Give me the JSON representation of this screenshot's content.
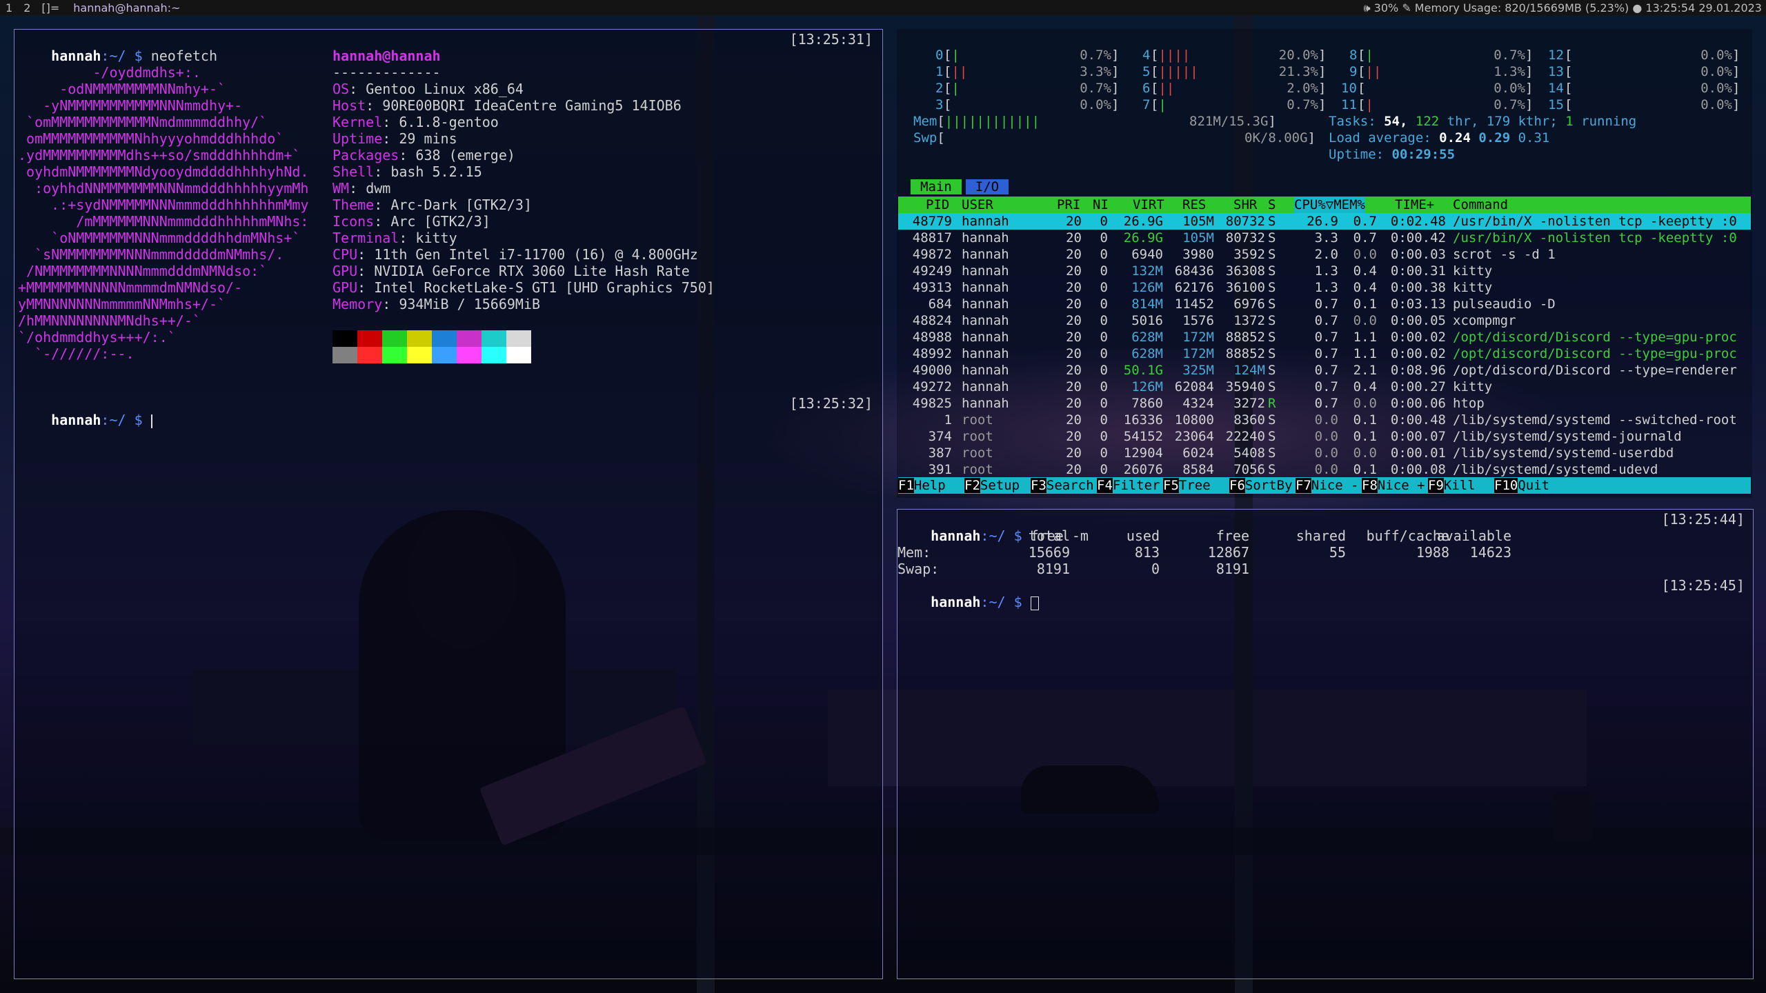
{
  "topbar": {
    "tags": [
      "1",
      "2"
    ],
    "layout": "[]=",
    "window_title": "hannah@hannah:~",
    "status": "🕪 30% ✎ Memory Usage: 820/15669MB (5.23%) ● 13:25:54 29.01.2023"
  },
  "left_terminal": {
    "cmd1": "neofetch",
    "ts1": "[13:25:31]",
    "ts2": "[13:25:32]",
    "prompt_user": "hannah",
    "prompt_path": ":~/ $",
    "ascii": [
      "         -/oyddmdhs+:.",
      "     -odNMMMMMMMMNNmhy+-`",
      "   -yNMMMMMMMMMMMNNNmmdhy+-",
      " `omMMMMMMMMMMMMNmdmmmmddhhy/`",
      " omMMMMMMMMMMMNhhyyyohmdddhhhdo`",
      ".ydMMMMMMMMMMdhs++so/smdddhhhhdm+`",
      " oyhdmNMMMMMMMNdyooydmddddhhhhyhNd.",
      "  :oyhhdNNMMMMMMMNNNmmdddhhhhhyymMh",
      "    .:+sydNMMMMMNNNmmmdddhhhhhhmMmy",
      "       /mMMMMMMNNNmmmdddhhhhhmMNhs:",
      "    `oNMMMMMMMNNNmmmddddhhdmMNhs+`",
      "  `sNMMMMMMMMNNNmmmdddddmNMmhs/.",
      " /NMMMMMMMMNNNNmmmdddmNMNdso:`",
      "+MMMMMMMNNNNNmmmmdmNMNdso/-",
      "yMMNNNNNNNmmmmmNNMmhs+/-`",
      "/hMMNNNNNNNNMNdhs++/-`",
      "`/ohdmmddhys+++/:.`",
      "  `-//////:--."
    ],
    "user_host": "hannah@hannah",
    "separator": "-------------",
    "info": [
      {
        "label": "OS",
        "value": "Gentoo Linux x86_64"
      },
      {
        "label": "Host",
        "value": "90RE00BQRI IdeaCentre Gaming5 14IOB6"
      },
      {
        "label": "Kernel",
        "value": "6.1.8-gentoo"
      },
      {
        "label": "Uptime",
        "value": "29 mins"
      },
      {
        "label": "Packages",
        "value": "638 (emerge)"
      },
      {
        "label": "Shell",
        "value": "bash 5.2.15"
      },
      {
        "label": "WM",
        "value": "dwm"
      },
      {
        "label": "Theme",
        "value": "Arc-Dark [GTK2/3]"
      },
      {
        "label": "Icons",
        "value": "Arc [GTK2/3]"
      },
      {
        "label": "Terminal",
        "value": "kitty"
      },
      {
        "label": "CPU",
        "value": "11th Gen Intel i7-11700 (16) @ 4.800GHz"
      },
      {
        "label": "GPU",
        "value": "NVIDIA GeForce RTX 3060 Lite Hash Rate"
      },
      {
        "label": "GPU",
        "value": "Intel RocketLake-S GT1 [UHD Graphics 750]"
      },
      {
        "label": "Memory",
        "value": "934MiB / 15669MiB"
      }
    ],
    "palette_top": [
      "#000000",
      "#cc0000",
      "#22cc22",
      "#cccc00",
      "#1e7fd6",
      "#c832c8",
      "#1ecbcb",
      "#d8d8d8"
    ],
    "palette_bottom": [
      "#808080",
      "#ff2a2a",
      "#33ff33",
      "#ffff2a",
      "#3aa0ff",
      "#ff44ff",
      "#2affff",
      "#ffffff"
    ]
  },
  "htop": {
    "cpus": [
      {
        "id": "0",
        "pct": "0.7%",
        "bars": "|"
      },
      {
        "id": "1",
        "pct": "3.3%",
        "bars": "||"
      },
      {
        "id": "2",
        "pct": "0.7%",
        "bars": "|"
      },
      {
        "id": "3",
        "pct": "0.0%",
        "bars": ""
      },
      {
        "id": "4",
        "pct": "20.0%",
        "bars": "||||"
      },
      {
        "id": "5",
        "pct": "21.3%",
        "bars": "|||||"
      },
      {
        "id": "6",
        "pct": "2.0%",
        "bars": "||"
      },
      {
        "id": "7",
        "pct": "0.7%",
        "bars": "|"
      },
      {
        "id": "8",
        "pct": "0.7%",
        "bars": "|"
      },
      {
        "id": "9",
        "pct": "1.3%",
        "bars": "||"
      },
      {
        "id": "10",
        "pct": "0.0%",
        "bars": ""
      },
      {
        "id": "11",
        "pct": "0.7%",
        "bars": "|"
      },
      {
        "id": "12",
        "pct": "0.0%",
        "bars": ""
      },
      {
        "id": "13",
        "pct": "0.0%",
        "bars": ""
      },
      {
        "id": "14",
        "pct": "0.0%",
        "bars": ""
      },
      {
        "id": "15",
        "pct": "0.0%",
        "bars": ""
      }
    ],
    "mem_label": "Mem",
    "mem_bars": "||||||||||||",
    "mem_value": "821M/15.3G",
    "swp_label": "Swp",
    "swp_value": "0K/8.00G",
    "tasks_label": "Tasks:",
    "tasks_n": "54,",
    "thr_n": "122",
    "tasks_rest": "thr, 179 kthr;",
    "running_n": "1",
    "running_label": "running",
    "load_label": "Load average:",
    "load1": "0.24",
    "load5": "0.29",
    "load15": "0.31",
    "uptime_label": "Uptime:",
    "uptime": "00:29:55",
    "tab_main": "Main",
    "tab_io": "I/O",
    "columns": [
      "PID",
      "USER",
      "PRI",
      "NI",
      "VIRT",
      "RES",
      "SHR",
      "S",
      "CPU%▽MEM%",
      "TIME+",
      "Command"
    ],
    "processes": [
      {
        "pid": "48779",
        "user": "hannah",
        "pri": "20",
        "ni": "0",
        "virt": "26.9G",
        "res": "105M",
        "shr": "80732",
        "s": "S",
        "cpu": "26.9",
        "mem": "0.7",
        "time": "0:02.48",
        "cmd": "/usr/bin/X -nolisten tcp -keeptty :0"
      },
      {
        "pid": "48817",
        "user": "hannah",
        "pri": "20",
        "ni": "0",
        "virt": "26.9G",
        "res": "105M",
        "shr": "80732",
        "s": "S",
        "cpu": "3.3",
        "mem": "0.7",
        "time": "0:00.42",
        "cmd": "/usr/bin/X -nolisten tcp -keeptty :0"
      },
      {
        "pid": "49872",
        "user": "hannah",
        "pri": "20",
        "ni": "0",
        "virt": "6940",
        "res": "3980",
        "shr": "3592",
        "s": "S",
        "cpu": "2.0",
        "mem": "0.0",
        "time": "0:00.03",
        "cmd": "scrot -s -d 1"
      },
      {
        "pid": "49249",
        "user": "hannah",
        "pri": "20",
        "ni": "0",
        "virt": "132M",
        "res": "68436",
        "shr": "36308",
        "s": "S",
        "cpu": "1.3",
        "mem": "0.4",
        "time": "0:00.31",
        "cmd": "kitty"
      },
      {
        "pid": "49313",
        "user": "hannah",
        "pri": "20",
        "ni": "0",
        "virt": "126M",
        "res": "62176",
        "shr": "36100",
        "s": "S",
        "cpu": "1.3",
        "mem": "0.4",
        "time": "0:00.38",
        "cmd": "kitty"
      },
      {
        "pid": "684",
        "user": "hannah",
        "pri": "20",
        "ni": "0",
        "virt": "814M",
        "res": "11452",
        "shr": "6976",
        "s": "S",
        "cpu": "0.7",
        "mem": "0.1",
        "time": "0:03.13",
        "cmd": "pulseaudio -D"
      },
      {
        "pid": "48824",
        "user": "hannah",
        "pri": "20",
        "ni": "0",
        "virt": "5016",
        "res": "1576",
        "shr": "1372",
        "s": "S",
        "cpu": "0.7",
        "mem": "0.0",
        "time": "0:00.05",
        "cmd": "xcompmgr"
      },
      {
        "pid": "48988",
        "user": "hannah",
        "pri": "20",
        "ni": "0",
        "virt": "628M",
        "res": "172M",
        "shr": "88852",
        "s": "S",
        "cpu": "0.7",
        "mem": "1.1",
        "time": "0:00.02",
        "cmd": "/opt/discord/Discord --type=gpu-proc"
      },
      {
        "pid": "48992",
        "user": "hannah",
        "pri": "20",
        "ni": "0",
        "virt": "628M",
        "res": "172M",
        "shr": "88852",
        "s": "S",
        "cpu": "0.7",
        "mem": "1.1",
        "time": "0:00.02",
        "cmd": "/opt/discord/Discord --type=gpu-proc"
      },
      {
        "pid": "49000",
        "user": "hannah",
        "pri": "20",
        "ni": "0",
        "virt": "50.1G",
        "res": "325M",
        "shr": "124M",
        "s": "S",
        "cpu": "0.7",
        "mem": "2.1",
        "time": "0:08.96",
        "cmd": "/opt/discord/Discord --type=renderer"
      },
      {
        "pid": "49272",
        "user": "hannah",
        "pri": "20",
        "ni": "0",
        "virt": "126M",
        "res": "62084",
        "shr": "35940",
        "s": "S",
        "cpu": "0.7",
        "mem": "0.4",
        "time": "0:00.27",
        "cmd": "kitty"
      },
      {
        "pid": "49825",
        "user": "hannah",
        "pri": "20",
        "ni": "0",
        "virt": "7860",
        "res": "4324",
        "shr": "3272",
        "s": "R",
        "cpu": "0.7",
        "mem": "0.0",
        "time": "0:00.06",
        "cmd": "htop"
      },
      {
        "pid": "1",
        "user": "root",
        "pri": "20",
        "ni": "0",
        "virt": "16336",
        "res": "10800",
        "shr": "8360",
        "s": "S",
        "cpu": "0.0",
        "mem": "0.1",
        "time": "0:00.48",
        "cmd": "/lib/systemd/systemd --switched-root"
      },
      {
        "pid": "374",
        "user": "root",
        "pri": "20",
        "ni": "0",
        "virt": "54152",
        "res": "23064",
        "shr": "22240",
        "s": "S",
        "cpu": "0.0",
        "mem": "0.1",
        "time": "0:00.07",
        "cmd": "/lib/systemd/systemd-journald"
      },
      {
        "pid": "387",
        "user": "root",
        "pri": "20",
        "ni": "0",
        "virt": "12904",
        "res": "6024",
        "shr": "5408",
        "s": "S",
        "cpu": "0.0",
        "mem": "0.0",
        "time": "0:00.01",
        "cmd": "/lib/systemd/systemd-userdbd"
      },
      {
        "pid": "391",
        "user": "root",
        "pri": "20",
        "ni": "0",
        "virt": "26076",
        "res": "8584",
        "shr": "7056",
        "s": "S",
        "cpu": "0.0",
        "mem": "0.1",
        "time": "0:00.08",
        "cmd": "/lib/systemd/systemd-udevd"
      }
    ],
    "fkeys": [
      {
        "key": "F1",
        "label": "Help"
      },
      {
        "key": "F2",
        "label": "Setup"
      },
      {
        "key": "F3",
        "label": "Search"
      },
      {
        "key": "F4",
        "label": "Filter"
      },
      {
        "key": "F5",
        "label": "Tree"
      },
      {
        "key": "F6",
        "label": "SortBy"
      },
      {
        "key": "F7",
        "label": "Nice -"
      },
      {
        "key": "F8",
        "label": "Nice +"
      },
      {
        "key": "F9",
        "label": "Kill"
      },
      {
        "key": "F10",
        "label": "Quit"
      }
    ]
  },
  "free_terminal": {
    "cmd": "free -m",
    "ts1": "[13:25:44]",
    "ts2": "[13:25:45]",
    "prompt_user": "hannah",
    "prompt_path": ":~/ $",
    "headers": [
      "total",
      "used",
      "free",
      "shared",
      "buff/cache",
      "available"
    ],
    "mem_label": "Mem:",
    "mem": [
      "15669",
      "813",
      "12867",
      "55",
      "1988",
      "14623"
    ],
    "swap_label": "Swap:",
    "swap": [
      "8191",
      "0",
      "8191"
    ]
  }
}
